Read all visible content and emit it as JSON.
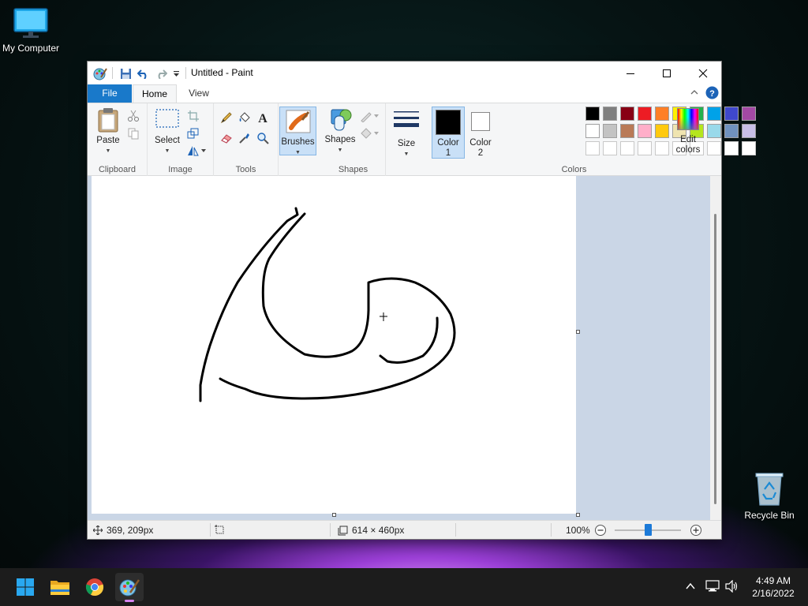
{
  "desktop": {
    "my_computer": "My Computer",
    "recycle_bin": "Recycle Bin"
  },
  "window": {
    "title": "Untitled - Paint",
    "tabs": {
      "file": "File",
      "home": "Home",
      "view": "View"
    },
    "ribbon": {
      "clipboard": {
        "paste": "Paste",
        "group": "Clipboard"
      },
      "image": {
        "select": "Select",
        "group": "Image"
      },
      "tools": {
        "group": "Tools"
      },
      "brushes": {
        "label": "Brushes"
      },
      "shapes": {
        "label": "Shapes",
        "group": "Shapes"
      },
      "size": {
        "label": "Size"
      },
      "color1": {
        "line1": "Color",
        "line2": "1"
      },
      "color2": {
        "line1": "Color",
        "line2": "2"
      },
      "edit_colors": {
        "line1": "Edit",
        "line2": "colors"
      },
      "colors_group": "Colors",
      "palette_row1": [
        "#000000",
        "#7f7f7f",
        "#880015",
        "#ed1c24",
        "#ff7f27",
        "#fff200",
        "#22b14c",
        "#00a2e8",
        "#3f48cc",
        "#a349a4"
      ],
      "palette_row2": [
        "#ffffff",
        "#c3c3c3",
        "#b97a57",
        "#ffaec9",
        "#ffc90e",
        "#efe4b0",
        "#b5e61d",
        "#99d9ea",
        "#7092be",
        "#c8bfe7"
      ]
    },
    "status": {
      "cursor_pos": "369, 209px",
      "canvas_size": "614 × 460px",
      "zoom": "100%",
      "zoom_slider": 0.5
    }
  },
  "taskbar": {
    "time": "4:49 AM",
    "date": "2/16/2022"
  }
}
